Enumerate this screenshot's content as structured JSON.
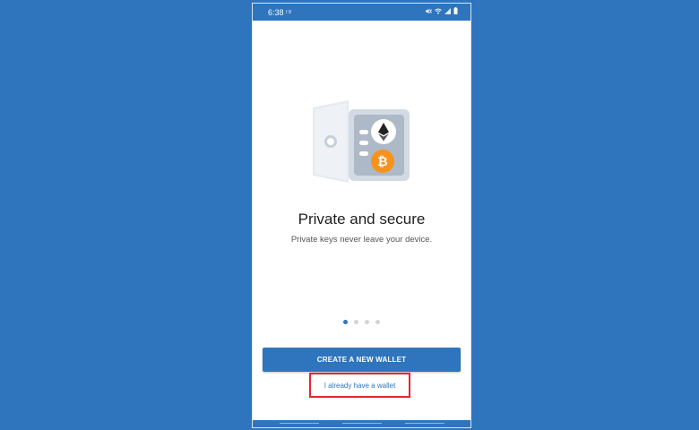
{
  "status_bar": {
    "time": "6:38",
    "carrier": "T9",
    "icons": [
      "mute-icon",
      "wifi-icon",
      "signal-icon",
      "battery-icon"
    ]
  },
  "onboarding": {
    "illustration": "safe-with-crypto-coins",
    "title": "Private and secure",
    "subtitle": "Private keys never leave your device.",
    "page_count": 4,
    "active_page": 1
  },
  "actions": {
    "create_label": "CREATE A NEW WALLET",
    "existing_label": "I already have a wallet"
  },
  "colors": {
    "accent": "#2f75bd",
    "highlight": "#e8242c",
    "bitcoin": "#f7931a"
  }
}
